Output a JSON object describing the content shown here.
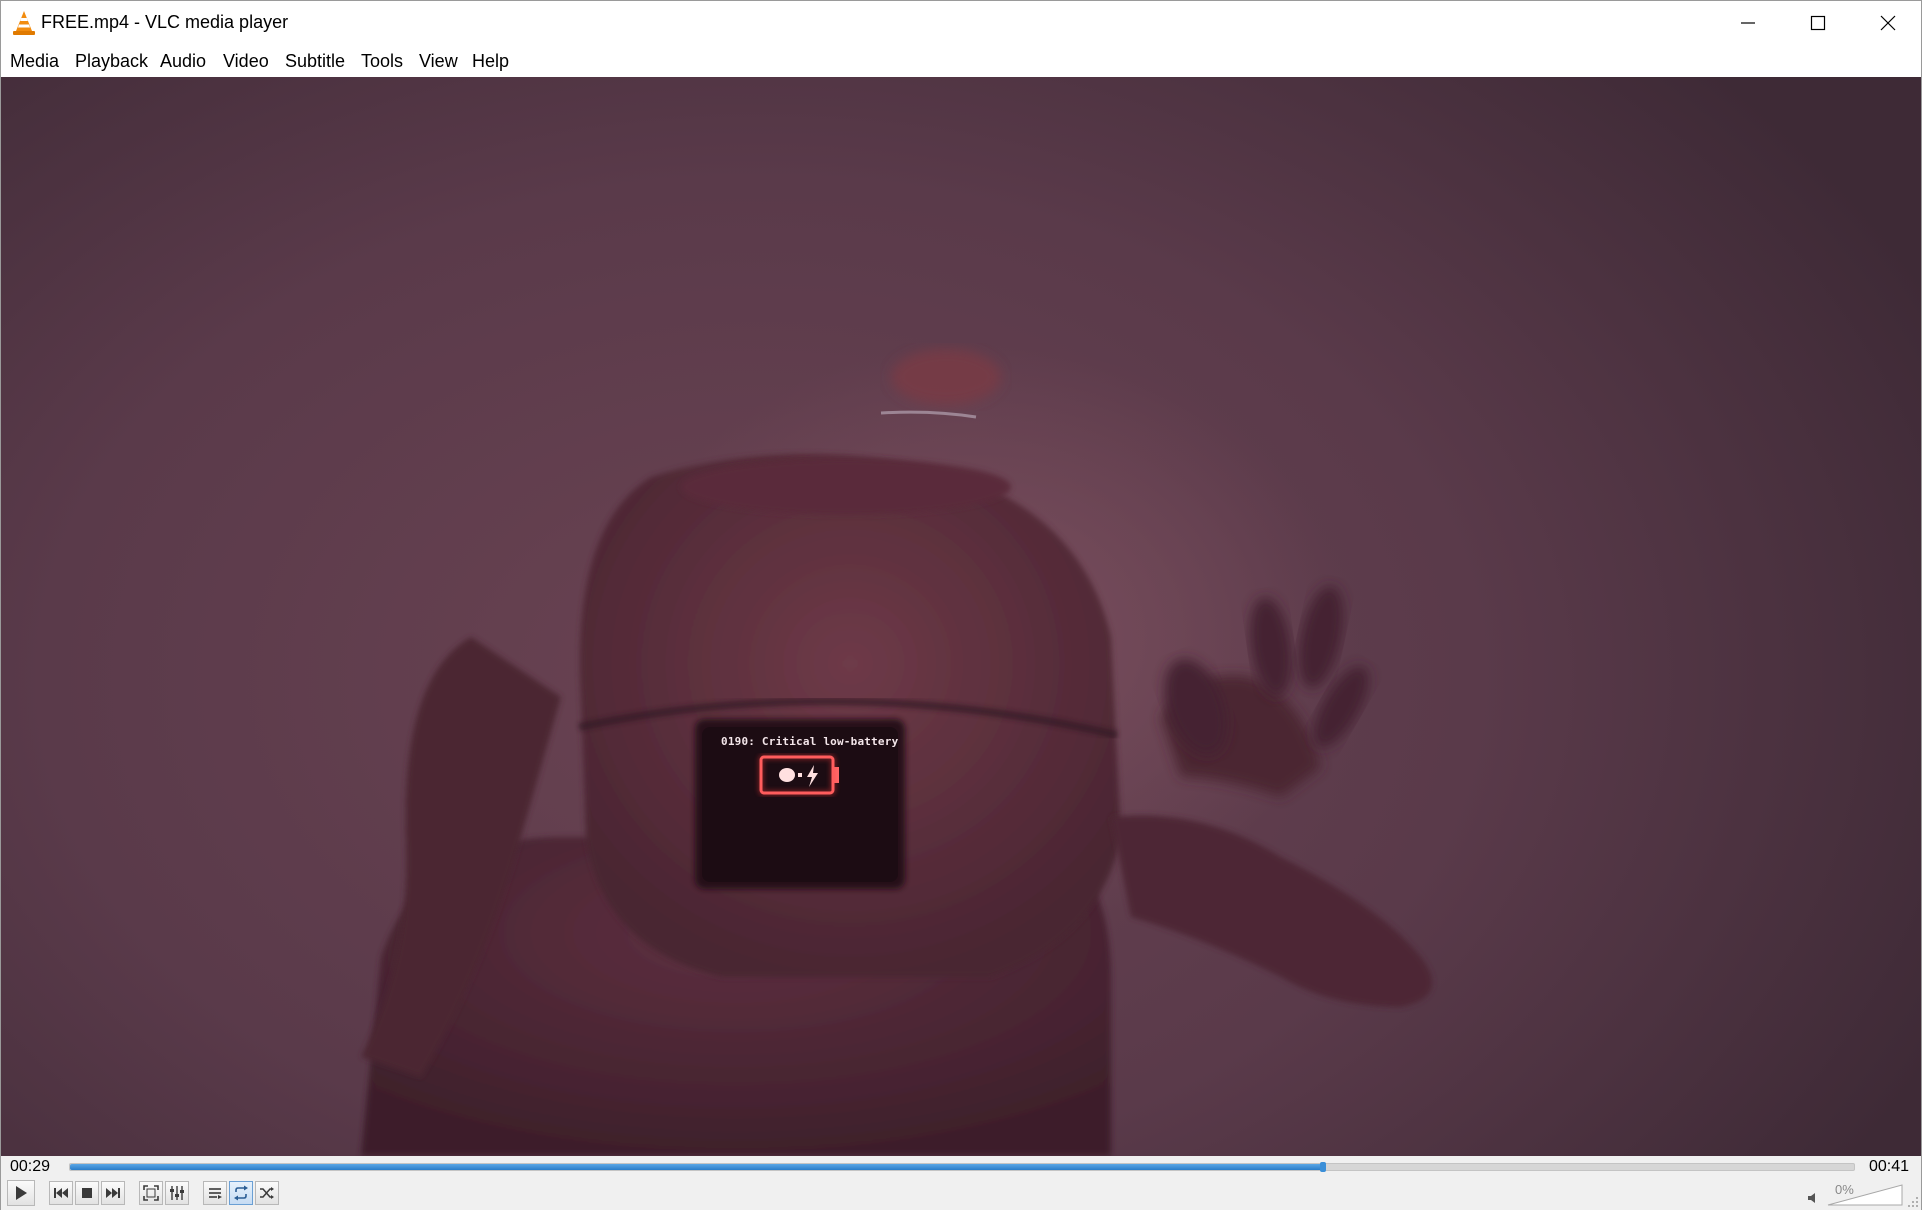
{
  "window": {
    "title": "FREE.mp4 - VLC media player",
    "app_icon": "vlc-cone-icon"
  },
  "menu": {
    "items": [
      "Media",
      "Playback",
      "Audio",
      "Video",
      "Subtitle",
      "Tools",
      "View",
      "Help"
    ]
  },
  "video": {
    "overlay_text": "0190: Critical low-battery"
  },
  "seek": {
    "elapsed": "00:29",
    "total": "00:41",
    "progress_fraction": 0.7025
  },
  "controls": {
    "buttons": [
      "play-icon",
      "previous-icon",
      "stop-icon",
      "next-icon",
      "fullscreen-icon",
      "extended-settings-icon",
      "playlist-icon",
      "loop-icon",
      "shuffle-icon"
    ],
    "loop_active": true
  },
  "volume": {
    "label": "0%",
    "level_fraction": 0
  },
  "colors": {
    "accent": "#2a7cc9",
    "battery_red": "#ff4a4a"
  }
}
